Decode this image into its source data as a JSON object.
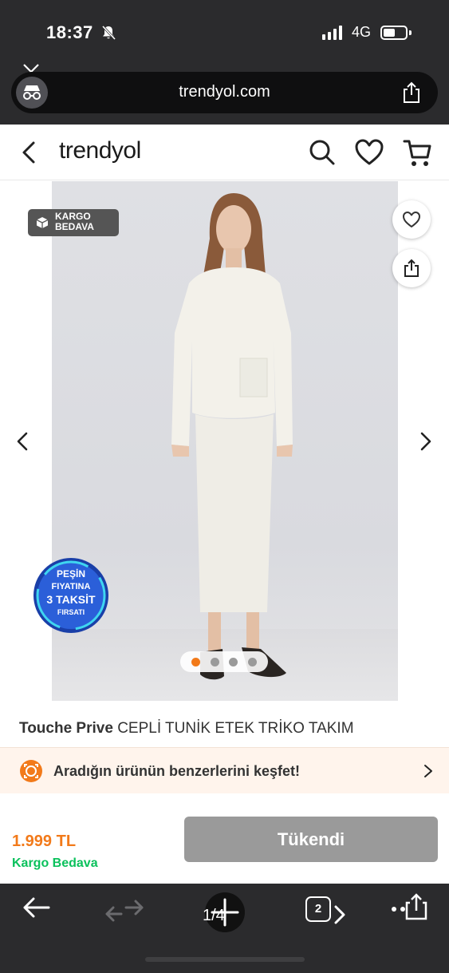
{
  "status_bar": {
    "time": "18:37",
    "network": "4G",
    "icons": [
      "bell-slash-icon",
      "signal-bars-icon",
      "battery-icon"
    ]
  },
  "browser": {
    "url": "trendyol.com",
    "close_icon": "close-icon",
    "incognito_icon": "incognito-icon",
    "share_icon": "share-icon"
  },
  "header": {
    "logo": "trendyol",
    "icons": [
      "back-chevron-icon",
      "search-icon",
      "heart-icon",
      "cart-icon"
    ]
  },
  "gallery": {
    "badge": {
      "line1": "KARGO",
      "line2": "BEDAVA"
    },
    "promo": {
      "line1": "PEŞİN",
      "line2": "FIYATINA",
      "line3": "3 TAKSİT",
      "line4": "FIRSATI"
    },
    "image_count": 4,
    "active_index": 0
  },
  "product": {
    "brand": "Touche Prive",
    "name": "CEPLİ TUNİK ETEK TRİKO TAKIM"
  },
  "similar": {
    "text": "Aradığın ürünün benzerlerini keşfet!"
  },
  "purchase": {
    "price": "1.999 TL",
    "shipping": "Kargo Bedava",
    "button": "Tükendi"
  },
  "toolbar": {
    "page_count": "1/4",
    "tabs_count": "2"
  },
  "colors": {
    "accent_orange": "#f27a1a",
    "shipping_green": "#0bc15c",
    "sold_out_grey": "#9a9a9a",
    "chrome_dark": "#2b2b2d"
  }
}
